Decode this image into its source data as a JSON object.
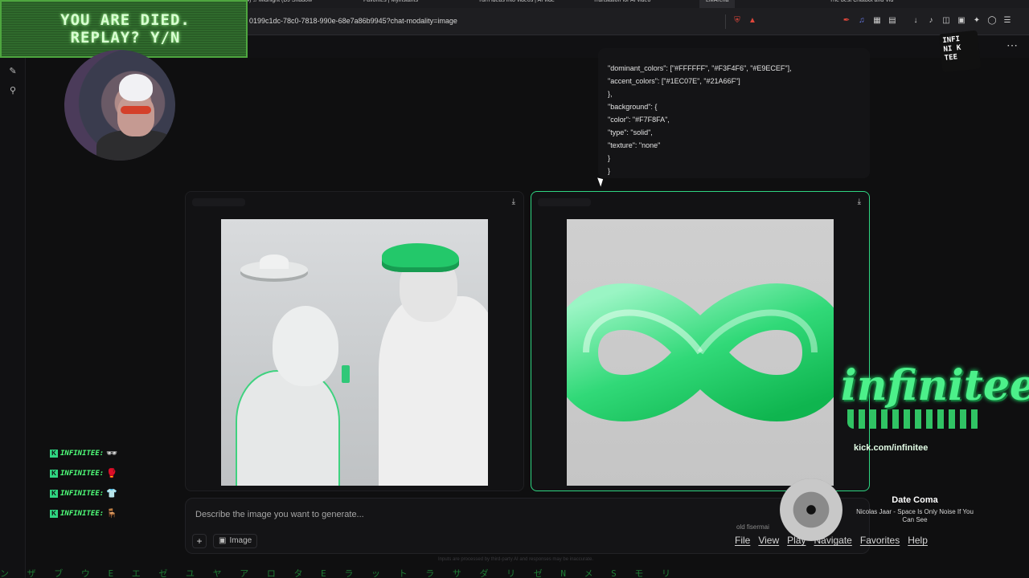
{
  "browser": {
    "tabs": [
      "(74) ♫ Midnight (DJ Shadow",
      "Favorites | Myinstants",
      "Turn ideas into videos | AI vide",
      "Translation for AI video",
      "LMArena",
      "The best Chatbot and Vid"
    ],
    "url": "0199c1dc-78c0-7818-990e-68e7a86b9945?chat-modality=image"
  },
  "overlay": {
    "died_text": "YOU ARE DIED.\nREPLAY? Y/N",
    "corner_logo": "INFI\nNI K\nTEE"
  },
  "json_block": {
    "lines": [
      "\"dominant_colors\": [\"#FFFFFF\", \"#F3F4F6\", \"#E9ECEF\"],",
      "\"accent_colors\": [\"#1EC07E\", \"#21A66F\"]",
      "},",
      "\"background\": {",
      "\"color\": \"#F7F8FA\",",
      "\"type\": \"solid\",",
      "\"texture\": \"none\"",
      "}",
      "}"
    ]
  },
  "composer": {
    "placeholder": "Describe the image you want to generate...",
    "image_chip": "Image",
    "plus": "+",
    "disclaimer": "Inputs are processed by third-party AI and responses may be inaccurate."
  },
  "chat": {
    "rows": [
      {
        "name": "INFINITEE:",
        "emote": "🕶"
      },
      {
        "name": "INFINITEE:",
        "emote": "🥊"
      },
      {
        "name": "INFINITEE:",
        "emote": "👕"
      },
      {
        "name": "INFINITEE:",
        "emote": "🪑"
      }
    ]
  },
  "brand": {
    "name": "infinitee",
    "url": "kick.com/infinitee"
  },
  "player": {
    "title": "Date Coma",
    "artist": "Nicolas Jaar - Space Is Only Noise If You Can See",
    "window_name": "old fisermai",
    "menu": [
      "File",
      "View",
      "Play",
      "Navigate",
      "Favorites",
      "Help"
    ]
  },
  "matrix": "ン ザ ブ ウ E エ ゼ ユ ヤ ア ロ タ E ラ ッ ト ラ サ ダ リ ゼ N メ S モ リ",
  "colors": {
    "accent": "#2fd582",
    "card_selected_border": "#2fd582",
    "background": "#0f0f10"
  }
}
